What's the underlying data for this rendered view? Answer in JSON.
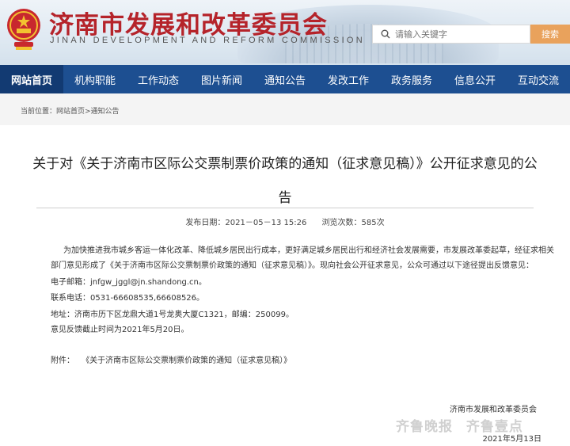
{
  "header": {
    "site_title": "济南市发展和改革委员会",
    "site_subtitle": "JINAN DEVELOPMENT AND REFORM COMMISSION",
    "search_placeholder": "请输入关键字",
    "search_button": "搜索",
    "brand_red": "#b5232a",
    "search_button_color": "#e9a25c"
  },
  "nav": {
    "color": "#1d4f91",
    "items": [
      {
        "label": "网站首页",
        "active": true
      },
      {
        "label": "机构职能"
      },
      {
        "label": "工作动态"
      },
      {
        "label": "图片新闻"
      },
      {
        "label": "通知公告"
      },
      {
        "label": "发改工作"
      },
      {
        "label": "政务服务"
      },
      {
        "label": "信息公开"
      },
      {
        "label": "互动交流"
      }
    ]
  },
  "breadcrumb": "当前位置：网站首页>通知公告",
  "article": {
    "title_line1": "关于对《关于济南市区际公交票制票价政策的通知（征求意见稿）》公开征求意见的公",
    "title_line2": "告",
    "publish_date": "发布日期：2021－05－13 15:26",
    "views": "浏览次数：585次",
    "para1": "为加快推进我市城乡客运一体化改革、降低城乡居民出行成本，更好满足城乡居民出行和经济社会发展需要，市发展改革委起草，经征求相关",
    "para2": "部门意见形成了《关于济南市区际公交票制票价政策的通知（征求意见稿）》。现向社会公开征求意见，公众可通过以下途径提出反馈意见：",
    "email": "电子邮箱：jnfgw_jggl@jn.shandong.cn。",
    "phone": "联系电话：0531-66608535,66608526。",
    "address": "地址：济南市历下区龙鼎大道1号龙奥大厦C1321，邮编：250099。",
    "deadline": "意见反馈截止时间为2021年5月20日。",
    "attachment_label": "附件：",
    "attachment_link": "《关于济南市区际公交票制票价政策的通知（征求意见稿）》",
    "signature": "济南市发展和改革委员会",
    "signature_date": "2021年5月13日"
  },
  "watermark": {
    "left": "齐鲁晚报",
    "right": "齐鲁壹点"
  }
}
